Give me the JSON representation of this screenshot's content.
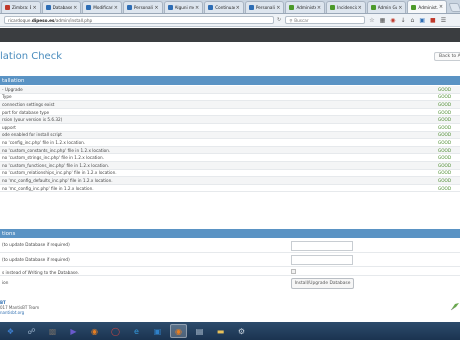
{
  "browser": {
    "tabs": [
      {
        "label": "Zimbra: Bandi...",
        "fav": "#c0392b",
        "active": false
      },
      {
        "label": "Database de...",
        "fav": "#2d6db5",
        "active": false
      },
      {
        "label": "Modificarit ta...",
        "fav": "#2d6db5",
        "active": false
      },
      {
        "label": "Personalizzat...",
        "fav": "#2d6db5",
        "active": false
      },
      {
        "label": "Alguni metet...",
        "fav": "#2d6db5",
        "active": false
      },
      {
        "label": "Continuaco' d...",
        "fav": "#2d6db5",
        "active": false
      },
      {
        "label": "Personalize I...",
        "fav": "#2d6db5",
        "active": false
      },
      {
        "label": "Administer C...",
        "fav": "#4c9a2a",
        "active": false
      },
      {
        "label": "Incidencias (d...",
        "fav": "#4c9a2a",
        "active": false
      },
      {
        "label": "Admin Guide",
        "fav": "#4c9a2a",
        "active": false
      },
      {
        "label": "Administ...",
        "fav": "#4c9a2a",
        "active": true
      }
    ],
    "url_prefix": "ricardoque.",
    "url_host": "dipeso.es",
    "url_path": "/admin/install.php",
    "search_placeholder": "Buscar"
  },
  "page": {
    "title": "lation Check",
    "back_button": "Back to Ad"
  },
  "installation": {
    "header": "tallation",
    "status_ok": "GOOD",
    "rows": [
      "- Upgrade",
      "Type",
      "connection settings exist",
      "port for database type",
      "rsion (your version is 5.6.32)",
      "upport",
      "ode enabled for install script",
      "no 'config_inc.php' file in 1.2.x location.",
      "no 'custom_constants_inc.php' file in 1.2.x location.",
      "no 'custom_strings_inc.php' file in 1.2.x location.",
      "no 'custom_functions_inc.php' file in 1.2.x location.",
      "no 'custom_relationships_inc.php' file in 1.2.x location.",
      "no 'mc_config_defaults_inc.php' file in 1.2.x location.",
      "no 'mc_config_inc.php' file in 1.2.x location."
    ]
  },
  "options": {
    "header": "tions",
    "field1_label": "(to update Database if required)",
    "field2_label": "(to update Database if required)",
    "field3_label": "s instead of Writing to the Database.",
    "field4_label": "ion",
    "install_button": "Install/Upgrade Database"
  },
  "footer": {
    "brand": "BT",
    "line2": "017 MantisBT Team",
    "line3": "nantisbt.org"
  },
  "taskbar": {
    "icons": [
      "start-icon",
      "explorer-icon",
      "cmd-icon",
      "media-icon",
      "firefox-icon",
      "chrome-icon",
      "ie-icon",
      "store-icon",
      "firefox-active-icon",
      "notepad-icon",
      "folder-icon",
      "settings-icon"
    ]
  }
}
